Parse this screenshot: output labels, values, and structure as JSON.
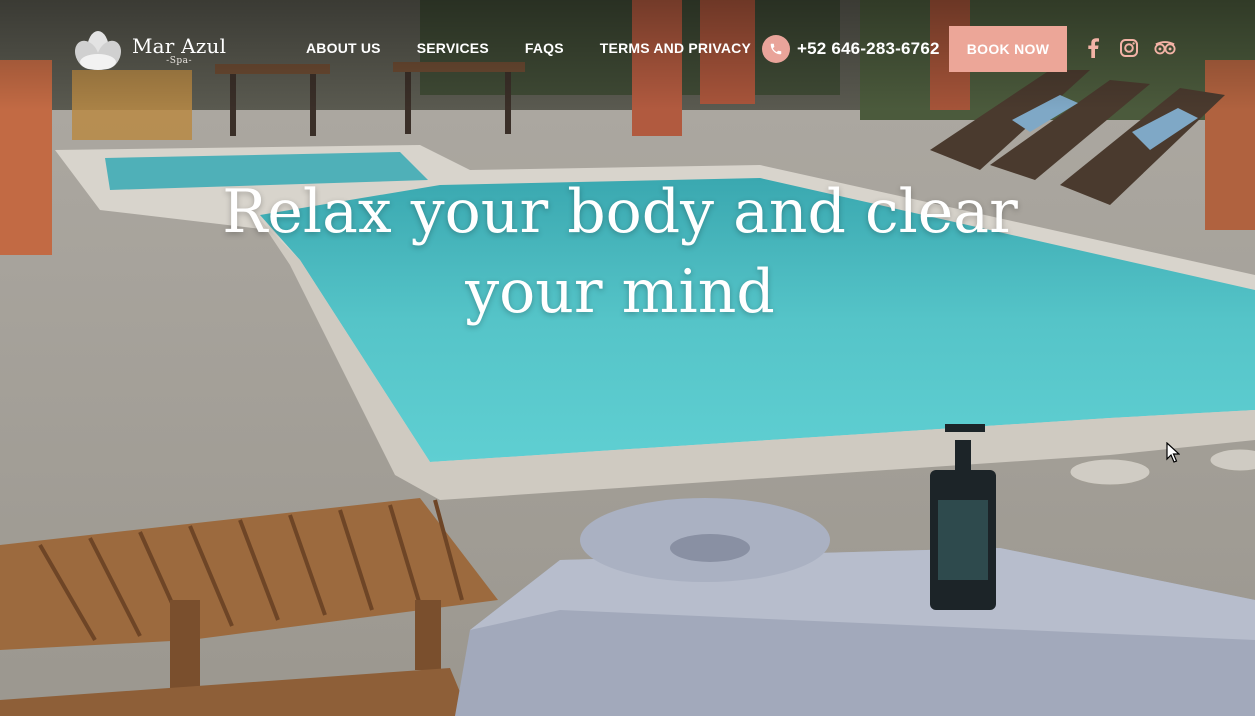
{
  "brand": {
    "name": "Mar Azul",
    "sub": "-Spa-",
    "logo_icon": "lotus-icon"
  },
  "nav": {
    "items": [
      "ABOUT US",
      "SERVICES",
      "FAQS",
      "TERMS AND PRIVACY"
    ],
    "phone": "+52 646-283-6762",
    "phone_icon": "phone-icon",
    "book_label": "BOOK NOW",
    "social_icons": [
      "facebook-icon",
      "instagram-icon",
      "tripadvisor-icon"
    ]
  },
  "hero": {
    "headline": "Relax your body and clear your mind"
  },
  "colors": {
    "accent": "#eca698",
    "pool": "#56c2c7",
    "text": "#ffffff"
  }
}
